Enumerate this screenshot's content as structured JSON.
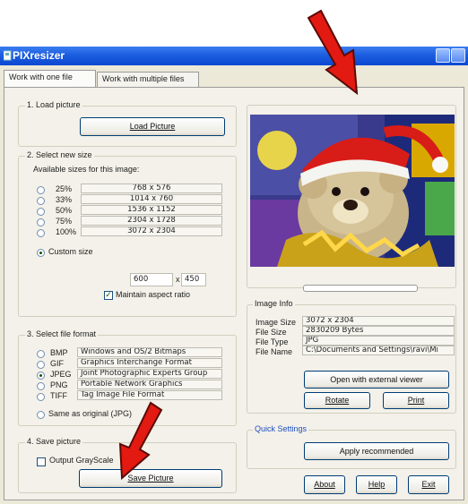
{
  "window": {
    "title": "PIXresizer"
  },
  "tabs": [
    "Work with one file",
    "Work with multiple files"
  ],
  "load": {
    "label": "1. Load picture",
    "button": "Load Picture"
  },
  "size": {
    "label": "2. Select new size",
    "available": "Available sizes for this image:",
    "options": [
      {
        "pct": "25%",
        "dims": "768 x 576"
      },
      {
        "pct": "33%",
        "dims": "1014 x 760"
      },
      {
        "pct": "50%",
        "dims": "1536 x 1152"
      },
      {
        "pct": "75%",
        "dims": "2304 x 1728"
      },
      {
        "pct": "100%",
        "dims": "3072 x 2304"
      }
    ],
    "custom_label": "Custom size",
    "width": "600",
    "height": "450",
    "times": "x",
    "aspect": "Maintain aspect ratio"
  },
  "format": {
    "label": "3. Select file format",
    "options": [
      {
        "name": "BMP",
        "desc": "Windows and OS/2 Bitmaps"
      },
      {
        "name": "GIF",
        "desc": "Graphics Interchange Format"
      },
      {
        "name": "JPEG",
        "desc": "Joint Photographic Experts Group"
      },
      {
        "name": "PNG",
        "desc": "Portable Network Graphics"
      },
      {
        "name": "TIFF",
        "desc": "Tag Image File Format"
      }
    ],
    "same": "Same as original (JPG)"
  },
  "save": {
    "label": "4. Save picture",
    "grayscale": "Output GrayScale",
    "button": "Save Picture"
  },
  "info": {
    "label": "Image Info",
    "rows": [
      {
        "k": "Image Size",
        "v": "3072 x 2304"
      },
      {
        "k": "File Size",
        "v": "2830209 Bytes"
      },
      {
        "k": "File Type",
        "v": "JPG"
      },
      {
        "k": "File Name",
        "v": "C:\\Documents and Settings\\ravi\\Mi"
      }
    ],
    "open_external": "Open with external viewer",
    "rotate": "Rotate",
    "print": "Print"
  },
  "quick": {
    "label": "Quick Settings",
    "apply": "Apply recommended"
  },
  "footer": {
    "about": "About",
    "help": "Help",
    "exit": "Exit"
  },
  "colors": {
    "titlebar": "#0a48d0",
    "annotation_arrow": "#e21a12",
    "groupbox_label_blue": "#1f4fbf"
  },
  "icons": {
    "arrow": "annotation-arrow",
    "app": "app-icon"
  }
}
